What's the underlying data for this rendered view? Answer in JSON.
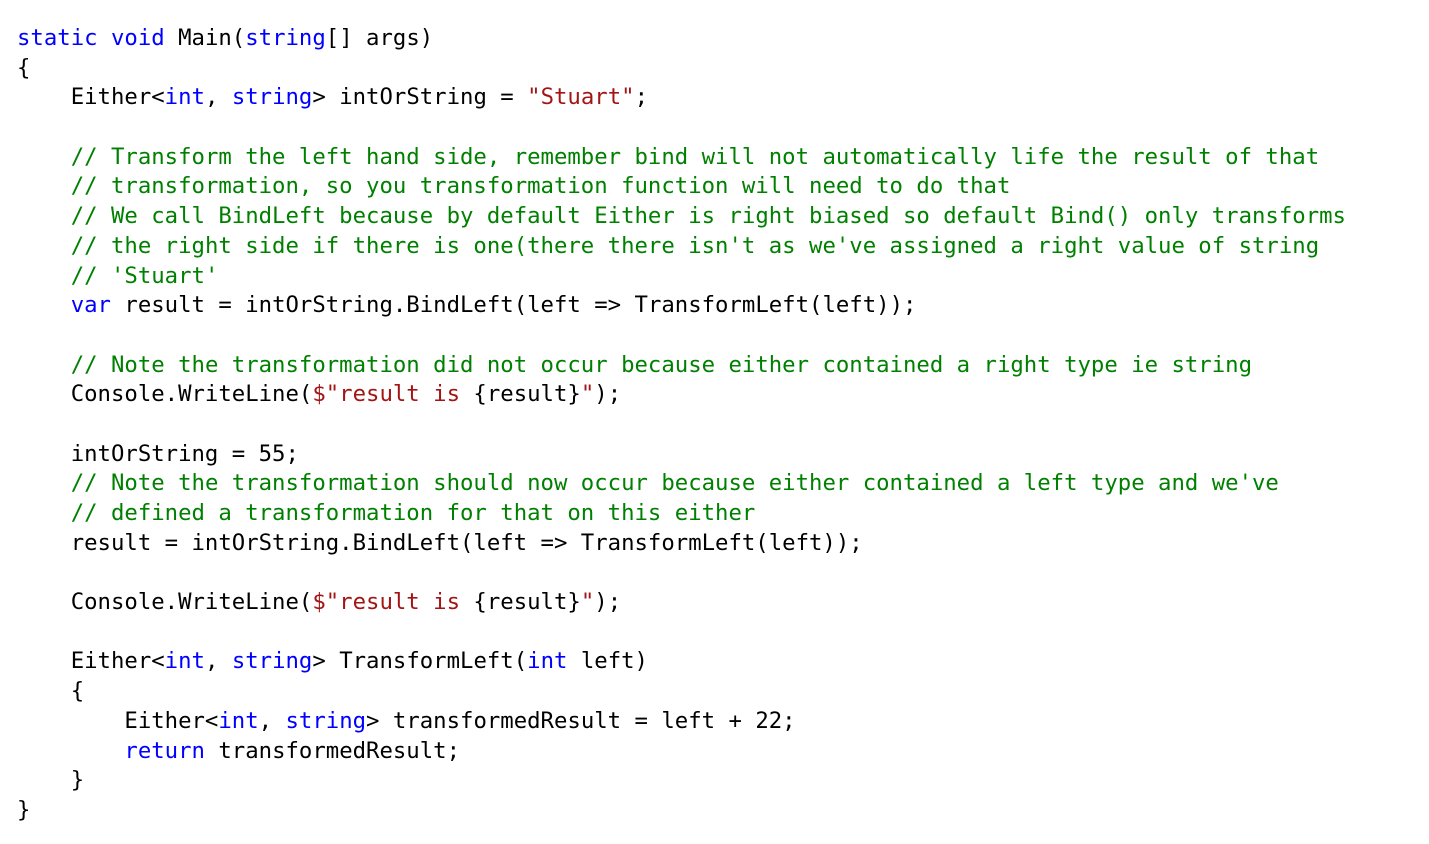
{
  "editor": {
    "lines": [
      [
        {
          "t": "kw",
          "x": "static"
        },
        {
          "t": "pl",
          "x": " "
        },
        {
          "t": "kw",
          "x": "void"
        },
        {
          "t": "pl",
          "x": " Main("
        },
        {
          "t": "kw",
          "x": "string"
        },
        {
          "t": "pl",
          "x": "[] args)"
        }
      ],
      [
        {
          "t": "pl",
          "x": "{"
        }
      ],
      [
        {
          "t": "pl",
          "x": "    Either<"
        },
        {
          "t": "kw",
          "x": "int"
        },
        {
          "t": "pl",
          "x": ", "
        },
        {
          "t": "kw",
          "x": "string"
        },
        {
          "t": "pl",
          "x": "> intOrString = "
        },
        {
          "t": "str",
          "x": "\"Stuart\""
        },
        {
          "t": "pl",
          "x": ";"
        }
      ],
      [],
      [
        {
          "t": "pl",
          "x": "    "
        },
        {
          "t": "cm",
          "x": "// Transform the left hand side, remember bind will not automatically life the result of that"
        }
      ],
      [
        {
          "t": "pl",
          "x": "    "
        },
        {
          "t": "cm",
          "x": "// transformation, so you transformation function will need to do that"
        }
      ],
      [
        {
          "t": "pl",
          "x": "    "
        },
        {
          "t": "cm",
          "x": "// We call BindLeft because by default Either is right biased so default Bind() only transforms"
        }
      ],
      [
        {
          "t": "pl",
          "x": "    "
        },
        {
          "t": "cm",
          "x": "// the right side if there is one(there there isn't as we've assigned a right value of string"
        }
      ],
      [
        {
          "t": "pl",
          "x": "    "
        },
        {
          "t": "cm",
          "x": "// 'Stuart'"
        }
      ],
      [
        {
          "t": "pl",
          "x": "    "
        },
        {
          "t": "kw",
          "x": "var"
        },
        {
          "t": "pl",
          "x": " result = intOrString.BindLeft(left => TransformLeft(left));"
        }
      ],
      [],
      [
        {
          "t": "pl",
          "x": "    "
        },
        {
          "t": "cm",
          "x": "// Note the transformation did not occur because either contained a right type ie string"
        }
      ],
      [
        {
          "t": "pl",
          "x": "    Console.WriteLine("
        },
        {
          "t": "str",
          "x": "$\"result is "
        },
        {
          "t": "pl",
          "x": "{result}"
        },
        {
          "t": "str",
          "x": "\""
        },
        {
          "t": "pl",
          "x": ");"
        }
      ],
      [],
      [
        {
          "t": "pl",
          "x": "    intOrString = 55;"
        }
      ],
      [
        {
          "t": "pl",
          "x": "    "
        },
        {
          "t": "cm",
          "x": "// Note the transformation should now occur because either contained a left type and we've"
        }
      ],
      [
        {
          "t": "pl",
          "x": "    "
        },
        {
          "t": "cm",
          "x": "// defined a transformation for that on this either"
        }
      ],
      [
        {
          "t": "pl",
          "x": "    result = intOrString.BindLeft(left => TransformLeft(left));"
        }
      ],
      [],
      [
        {
          "t": "pl",
          "x": "    Console.WriteLine("
        },
        {
          "t": "str",
          "x": "$\"result is "
        },
        {
          "t": "pl",
          "x": "{result}"
        },
        {
          "t": "str",
          "x": "\""
        },
        {
          "t": "pl",
          "x": ");"
        }
      ],
      [],
      [
        {
          "t": "pl",
          "x": "    Either<"
        },
        {
          "t": "kw",
          "x": "int"
        },
        {
          "t": "pl",
          "x": ", "
        },
        {
          "t": "kw",
          "x": "string"
        },
        {
          "t": "pl",
          "x": "> TransformLeft("
        },
        {
          "t": "kw",
          "x": "int"
        },
        {
          "t": "pl",
          "x": " left)"
        }
      ],
      [
        {
          "t": "pl",
          "x": "    {"
        }
      ],
      [
        {
          "t": "pl",
          "x": "        Either<"
        },
        {
          "t": "kw",
          "x": "int"
        },
        {
          "t": "pl",
          "x": ", "
        },
        {
          "t": "kw",
          "x": "string"
        },
        {
          "t": "pl",
          "x": "> transformedResult = left + 22;"
        }
      ],
      [
        {
          "t": "pl",
          "x": "        "
        },
        {
          "t": "kw",
          "x": "return"
        },
        {
          "t": "pl",
          "x": " transformedResult;"
        }
      ],
      [
        {
          "t": "pl",
          "x": "    }"
        }
      ],
      [
        {
          "t": "pl",
          "x": "}"
        }
      ]
    ]
  },
  "colors": {
    "keyword": "#0000ff",
    "string": "#a31515",
    "comment": "#008000",
    "plain": "#000000",
    "background": "#ffffff"
  }
}
